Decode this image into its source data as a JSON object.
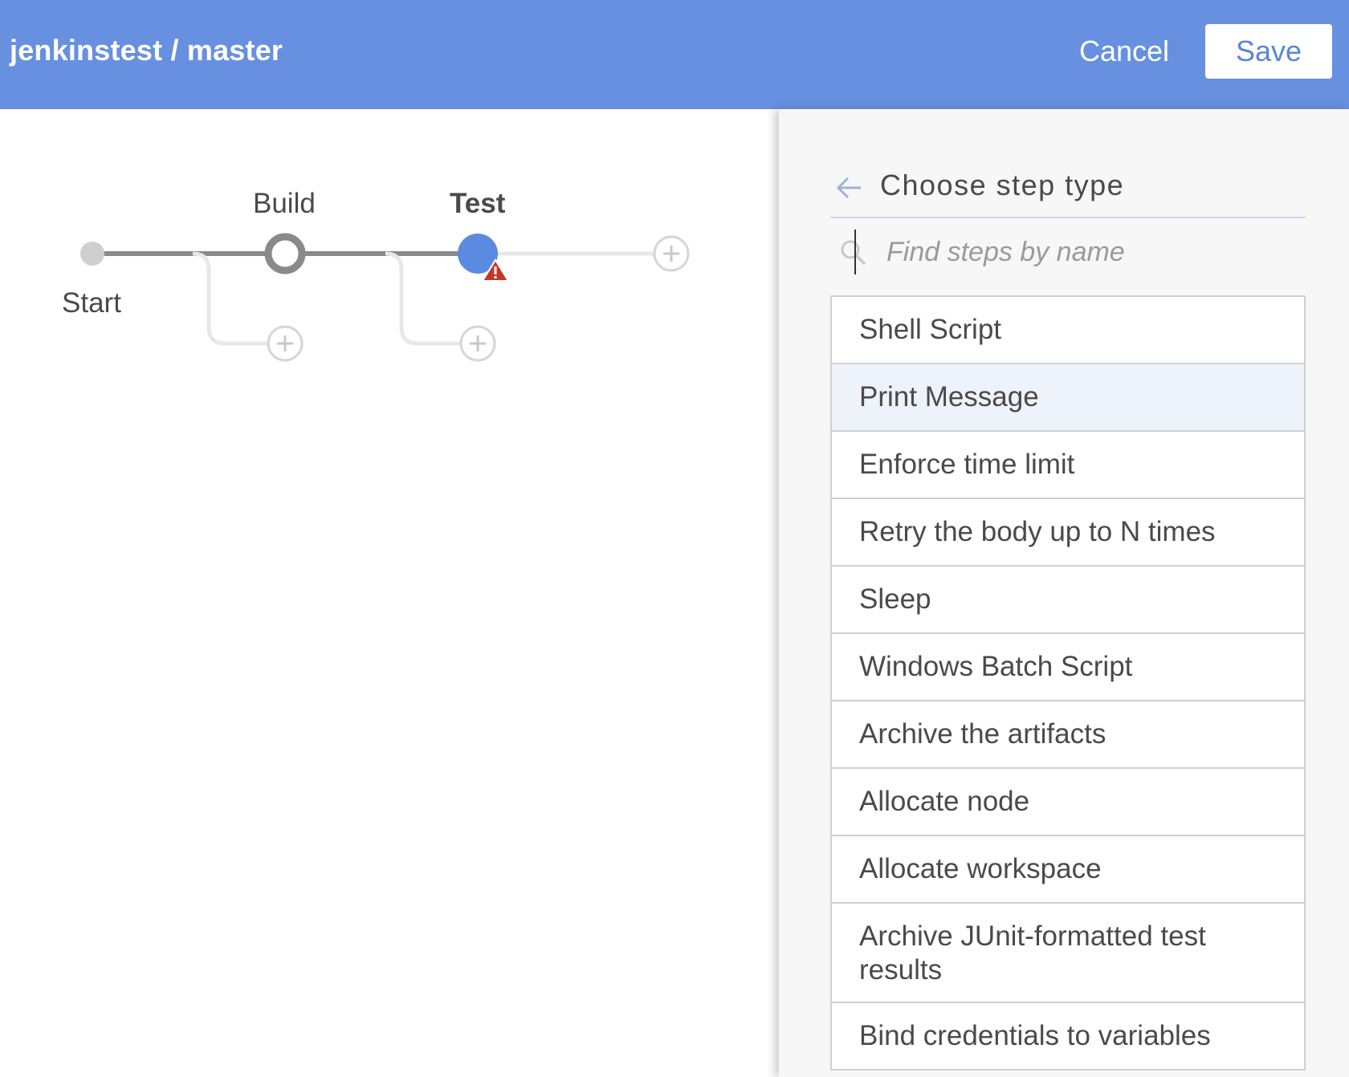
{
  "header": {
    "title": "jenkinstest / master",
    "cancel_label": "Cancel",
    "save_label": "Save"
  },
  "pipeline": {
    "start_label": "Start",
    "stages": [
      {
        "name": "Build",
        "selected": false
      },
      {
        "name": "Test",
        "selected": true,
        "warning": true
      }
    ],
    "colors": {
      "active_line": "#8a8a8a",
      "inactive_line": "#e8e8e8",
      "selected_node": "#5b8be0",
      "warning": "#c0392b"
    }
  },
  "panel": {
    "back_icon": "arrow-left-icon",
    "title": "Choose step type",
    "search": {
      "icon": "search-icon",
      "placeholder": "Find steps by name",
      "value": ""
    },
    "highlighted_index": 1,
    "steps": [
      "Shell Script",
      "Print Message",
      "Enforce time limit",
      "Retry the body up to N times",
      "Sleep",
      "Windows Batch Script",
      "Archive the artifacts",
      "Allocate node",
      "Allocate workspace",
      "Archive JUnit-formatted test results",
      "Bind credentials to variables"
    ]
  }
}
